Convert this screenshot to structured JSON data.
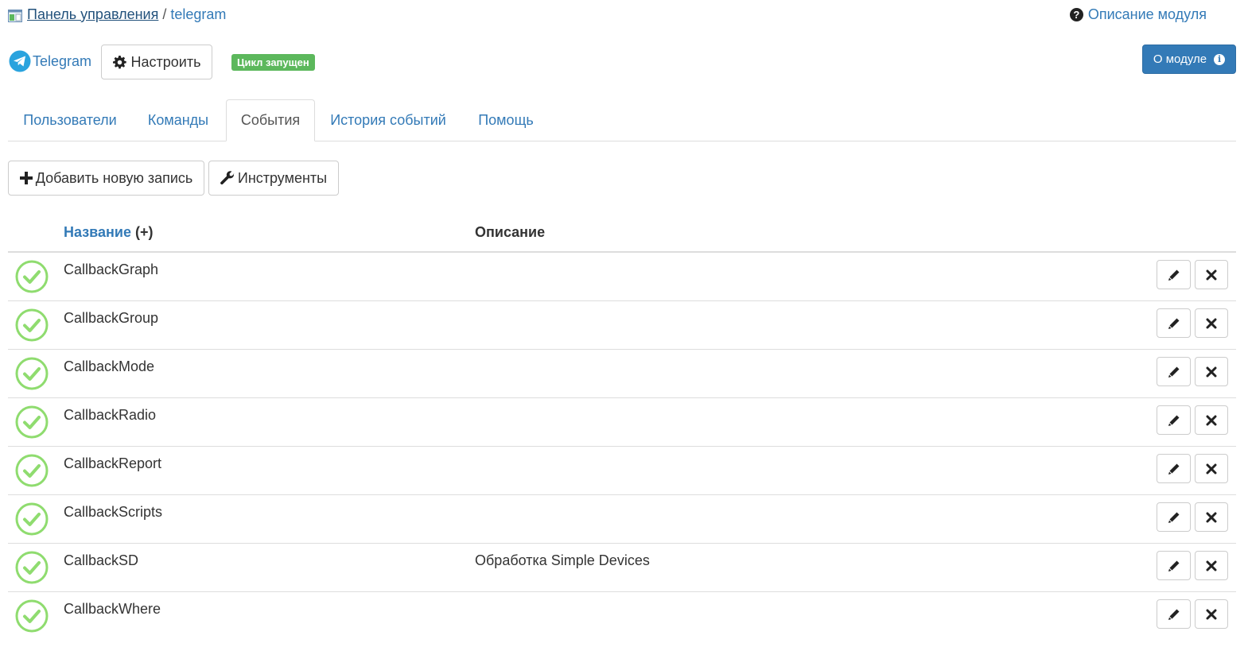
{
  "breadcrumb": {
    "root": "Панель управления",
    "separator": "/",
    "current": "telegram"
  },
  "header": {
    "module_help": "Описание модуля",
    "module_name": "Telegram",
    "setup_button": "Настроить",
    "status_badge": "Цикл запущен",
    "about_button": "О модуле"
  },
  "tabs": [
    {
      "label": "Пользователи",
      "active": false
    },
    {
      "label": "Команды",
      "active": false
    },
    {
      "label": "События",
      "active": true
    },
    {
      "label": "История событий",
      "active": false
    },
    {
      "label": "Помощь",
      "active": false
    }
  ],
  "toolbar": {
    "add_label": "Добавить новую запись",
    "tools_label": "Инструменты"
  },
  "table": {
    "col_name": "Название",
    "col_name_sort": "(+)",
    "col_desc": "Описание",
    "rows": [
      {
        "name": "CallbackGraph",
        "description": ""
      },
      {
        "name": "CallbackGroup",
        "description": ""
      },
      {
        "name": "CallbackMode",
        "description": ""
      },
      {
        "name": "CallbackRadio",
        "description": ""
      },
      {
        "name": "CallbackReport",
        "description": ""
      },
      {
        "name": "CallbackScripts",
        "description": ""
      },
      {
        "name": "CallbackSD",
        "description": "Обработка Simple Devices"
      },
      {
        "name": "CallbackWhere",
        "description": ""
      }
    ]
  },
  "colors": {
    "link": "#337ab7",
    "primary_button": "#337ab7",
    "success_badge": "#5cb85c",
    "ok_icon": "#8fdc6f",
    "telegram": "#2aa3de"
  },
  "icons": {
    "breadcrumb": "control-panel-icon",
    "help": "question-circle-icon",
    "telegram": "telegram-icon",
    "setup": "gear-icon",
    "about": "info-circle-icon",
    "add": "plus-icon",
    "tools": "wrench-icon",
    "row_status": "check-circle-icon",
    "row_edit": "pencil-icon",
    "row_delete": "close-icon"
  }
}
